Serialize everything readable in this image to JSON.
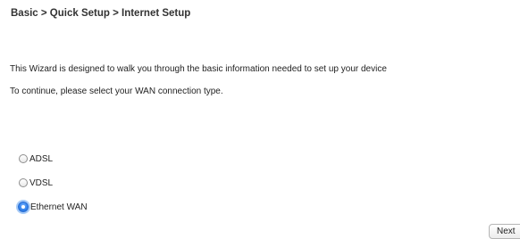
{
  "breadcrumb": "Basic > Quick Setup > Internet Setup",
  "intro": {
    "line1": "This Wizard is designed to walk you through the basic information needed to set up your device",
    "line2": "To continue, please select your WAN connection type."
  },
  "wan_options": [
    {
      "label": "ADSL",
      "selected": false
    },
    {
      "label": "VDSL",
      "selected": false
    },
    {
      "label": "Ethernet WAN",
      "selected": true
    }
  ],
  "next_label": "Next",
  "colors": {
    "selected_radio": "#2f80ea"
  }
}
